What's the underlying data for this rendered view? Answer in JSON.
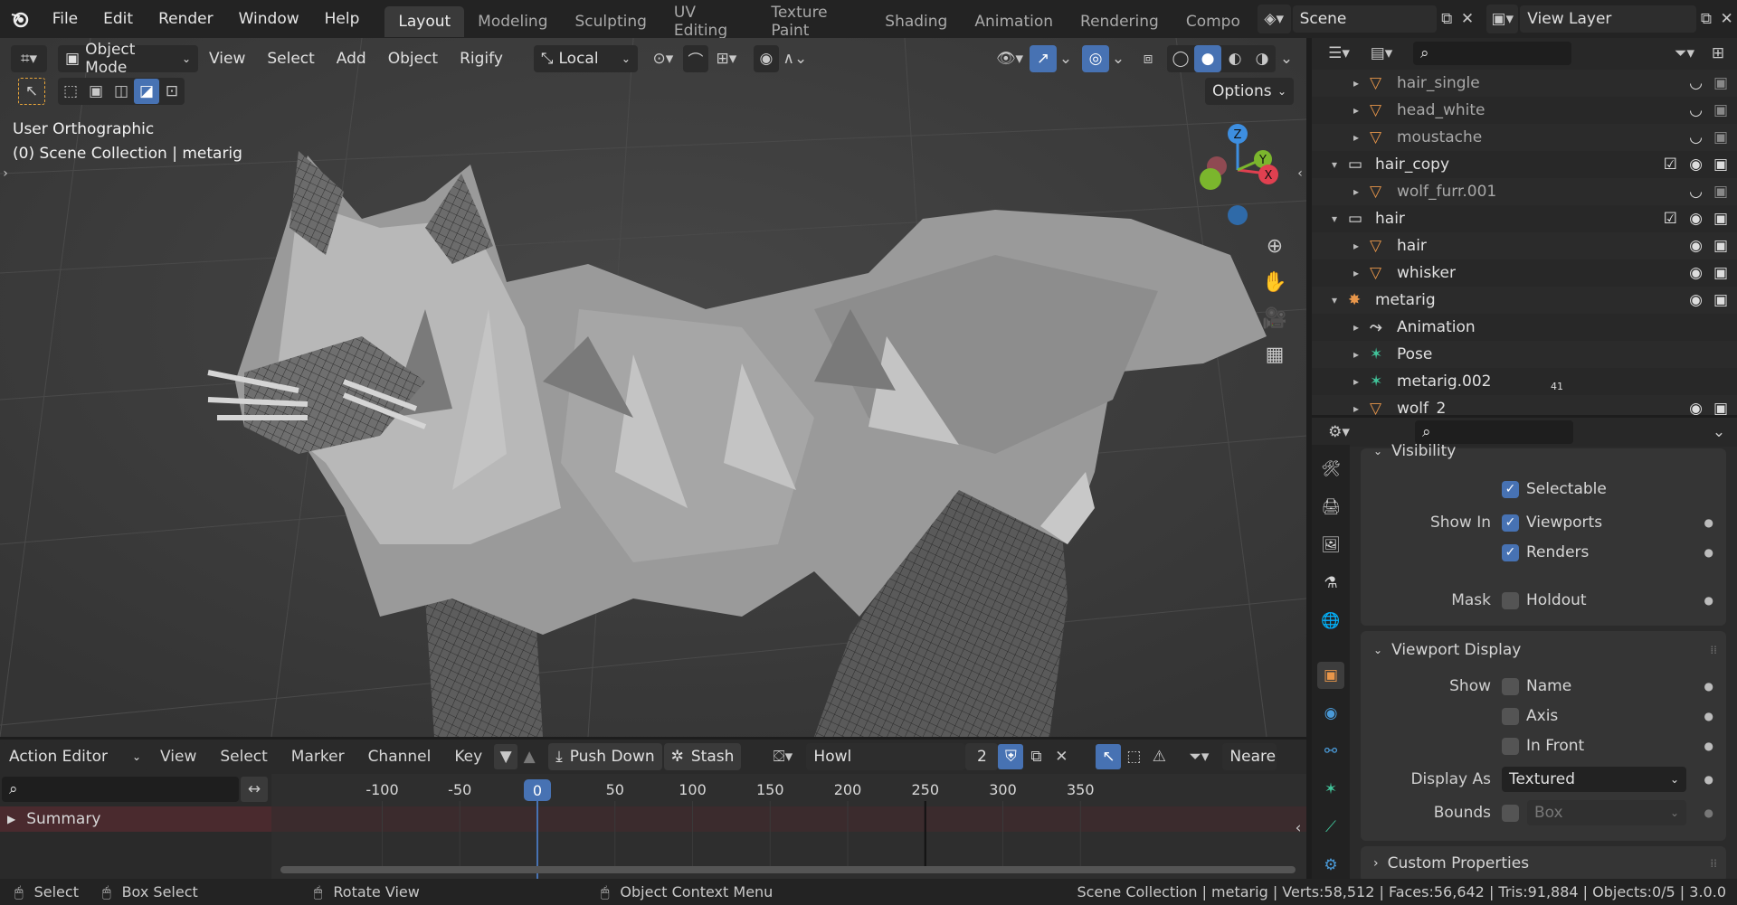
{
  "topbar": {
    "menus": [
      "File",
      "Edit",
      "Render",
      "Window",
      "Help"
    ],
    "workspaces": [
      "Layout",
      "Modeling",
      "Sculpting",
      "UV Editing",
      "Texture Paint",
      "Shading",
      "Animation",
      "Rendering",
      "Compo"
    ],
    "scene": "Scene",
    "view_layer": "View Layer"
  },
  "viewport": {
    "mode": "Object Mode",
    "menus": [
      "View",
      "Select",
      "Add",
      "Object",
      "Rigify"
    ],
    "transform": "Local",
    "options": "Options",
    "info_view": "User Orthographic",
    "info_collection": "(0) Scene Collection | metarig",
    "gizmo": {
      "z": "Z",
      "y": "Y",
      "x": "X"
    }
  },
  "outliner": {
    "rows": [
      {
        "label": "hair_single",
        "indent": 2,
        "icon": "mesh-icon",
        "dim": true
      },
      {
        "label": "head_white",
        "indent": 2,
        "icon": "mesh-icon",
        "dim": true
      },
      {
        "label": "moustache",
        "indent": 2,
        "icon": "mesh-icon",
        "dim": true
      },
      {
        "label": "hair_copy",
        "indent": 1,
        "icon": "collection-icon",
        "dim": false
      },
      {
        "label": "wolf_furr.001",
        "indent": 2,
        "icon": "mesh-icon",
        "dim": true
      },
      {
        "label": "hair",
        "indent": 1,
        "icon": "collection-icon",
        "dim": false
      },
      {
        "label": "hair",
        "indent": 2,
        "icon": "mesh-icon",
        "dim": false
      },
      {
        "label": "whisker",
        "indent": 2,
        "icon": "mesh-icon",
        "dim": false
      },
      {
        "label": "metarig",
        "indent": 1,
        "icon": "armature-icon",
        "dim": false
      },
      {
        "label": "Animation",
        "indent": 2,
        "icon": "animation-icon",
        "dim": false
      },
      {
        "label": "Pose",
        "indent": 2,
        "icon": "pose-icon",
        "dim": false
      },
      {
        "label": "metarig.002",
        "indent": 2,
        "icon": "armature-data-icon",
        "dim": false,
        "badge": "41"
      },
      {
        "label": "wolf_2",
        "indent": 2,
        "icon": "mesh-icon",
        "dim": false
      }
    ]
  },
  "properties": {
    "visibility_title": "Visibility",
    "selectable": "Selectable",
    "show_in": "Show In",
    "viewports": "Viewports",
    "renders": "Renders",
    "mask": "Mask",
    "holdout": "Holdout",
    "viewport_display": "Viewport Display",
    "show": "Show",
    "name": "Name",
    "axis": "Axis",
    "in_front": "In Front",
    "display_as": "Display As",
    "display_as_value": "Textured",
    "bounds": "Bounds",
    "bounds_value": "Box",
    "custom_properties": "Custom Properties"
  },
  "action_editor": {
    "mode": "Action Editor",
    "menus": [
      "View",
      "Select",
      "Marker",
      "Channel",
      "Key"
    ],
    "push_down": "Push Down",
    "stash": "Stash",
    "action_name": "Howl",
    "users": "2",
    "nearest": "Neare",
    "summary": "Summary",
    "current_frame": "0",
    "ticks": [
      "-100",
      "-50",
      "0",
      "50",
      "100",
      "150",
      "200",
      "250",
      "300",
      "350"
    ]
  },
  "status": {
    "select": "Select",
    "box_select": "Box Select",
    "rotate_view": "Rotate View",
    "context_menu": "Object Context Menu",
    "stats": "Scene Collection | metarig | Verts:58,512 | Faces:56,642 | Tris:91,884 | Objects:0/5 | 3.0.0"
  },
  "colors": {
    "accent": "#4772b3",
    "x_axis": "#e04050",
    "y_axis": "#7bb62d",
    "z_axis": "#3d8ee0",
    "mesh_orange": "#e8964a",
    "armature_green": "#41c49a"
  }
}
